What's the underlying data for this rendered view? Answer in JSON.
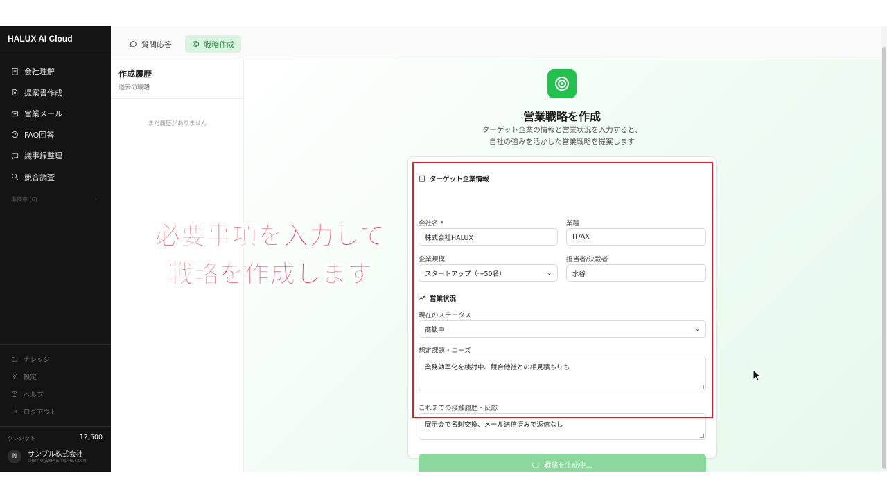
{
  "app": {
    "brand": "HALUX AI Cloud"
  },
  "sidebar": {
    "items": [
      {
        "label": "会社理解",
        "icon": "building-icon"
      },
      {
        "label": "提案書作成",
        "icon": "document-icon"
      },
      {
        "label": "営業メール",
        "icon": "mail-icon"
      },
      {
        "label": "FAQ回答",
        "icon": "help-icon"
      },
      {
        "label": "議事録整理",
        "icon": "chat-icon"
      },
      {
        "label": "競合調査",
        "icon": "search-icon"
      }
    ],
    "preparing": "準備中 (6)",
    "bottom_items": [
      {
        "label": "ナレッジ",
        "icon": "folder-icon"
      },
      {
        "label": "設定",
        "icon": "gear-icon"
      },
      {
        "label": "ヘルプ",
        "icon": "help-icon"
      },
      {
        "label": "ログアウト",
        "icon": "logout-icon"
      }
    ],
    "credit_label": "クレジット",
    "credit_value": "12,500",
    "avatar_initial": "N",
    "org_name": "サンプル株式会社",
    "org_email": "demo@example.com"
  },
  "tabs": [
    {
      "label": "質問応答",
      "icon": "chat-icon",
      "active": false
    },
    {
      "label": "戦略作成",
      "icon": "target-icon",
      "active": true
    }
  ],
  "history": {
    "title": "作成履歴",
    "subtitle": "過去の戦略",
    "empty": "まだ履歴がありません"
  },
  "hero": {
    "title": "営業戦略を作成",
    "desc_line1": "ターゲット企業の情報と営業状況を入力すると、",
    "desc_line2": "自社の強みを活かした営業戦略を提案します"
  },
  "form": {
    "target_section": "ターゲット企業情報",
    "company_label": "会社名 *",
    "company_value": "株式会社HALUX",
    "industry_label": "業種",
    "industry_value": "IT/AX",
    "size_label": "企業規模",
    "size_value": "スタートアップ（〜50名）",
    "contact_label": "担当者/決裁者",
    "contact_value": "水谷",
    "sales_section": "営業状況",
    "status_label": "現在のステータス",
    "status_value": "商談中",
    "needs_label": "想定課題・ニーズ",
    "needs_value": "業務効率化を検討中、競合他社との相見積もりも",
    "history_label": "これまでの接触履歴・反応",
    "history_value": "展示会で名刺交換、メール送信済みで返信なし",
    "submit_label": "戦略を生成中..."
  },
  "overlay": {
    "line1": "必要事項を入力して",
    "line2": "戦略を作成します"
  },
  "colors": {
    "accent": "#22c14e",
    "highlight": "#e21b2d",
    "sidebar_bg": "#141414"
  }
}
